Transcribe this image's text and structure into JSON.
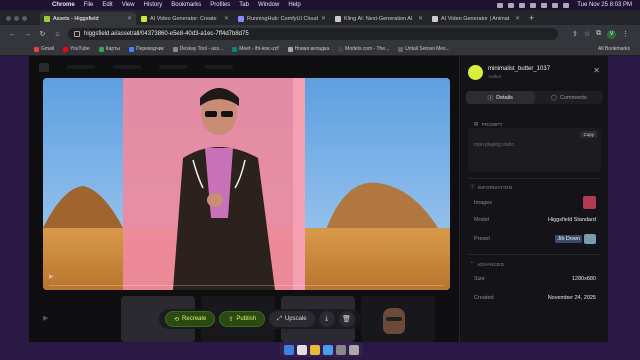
{
  "menubar": {
    "app_name": "Chrome",
    "items": [
      "File",
      "Edit",
      "View",
      "History",
      "Bookmarks",
      "Profiles",
      "Tab",
      "Window",
      "Help"
    ],
    "clock": "Tue Nov 25  8:03 PM"
  },
  "tabs": [
    {
      "title": "Assets - Higgsfield",
      "color": "#9acd32",
      "active": true
    },
    {
      "title": "AI Video Generator: Create",
      "color": "#c8e63c",
      "active": false
    },
    {
      "title": "RunningHub: ComfyUI Cloud",
      "color": "#8888ff",
      "active": false
    },
    {
      "title": "Kling AI: Next-Generation AI",
      "color": "#cccccc",
      "active": false
    },
    {
      "title": "AI Video Generator | Animat",
      "color": "#cccccc",
      "active": false
    }
  ],
  "address_bar": {
    "url": "higgsfield.ai/asset/all/04373860-e5e8-40d3-a1ec-7ff4d7b8d75"
  },
  "bookmarks": [
    {
      "label": "Gmail",
      "color": "#ea4335"
    },
    {
      "label": "YouTube",
      "color": "#ff0000"
    },
    {
      "label": "Карты",
      "color": "#34a853"
    },
    {
      "label": "Переводчик",
      "color": "#4285f4"
    },
    {
      "label": "Deskay Tool - ass...",
      "color": "#888888"
    },
    {
      "label": "Meet - iht-iesc-zzf",
      "color": "#00897b"
    },
    {
      "label": "Новая вкладка",
      "color": "#aaaaaa"
    },
    {
      "label": "Models.com - The...",
      "color": "#444444"
    },
    {
      "label": "Untail Sensei Mes...",
      "color": "#666666"
    }
  ],
  "bookmarks_all": "All Bookmarks",
  "actions": {
    "recreate": "Recreate",
    "publish": "Publish",
    "upscale": "Upscale"
  },
  "panel": {
    "username": "minimalist_butter_1037",
    "user_subtitle": "Author",
    "tab_details": "Details",
    "tab_comments": "Comments",
    "prompt_heading": "PROMPT",
    "copy_label": "Copy",
    "prompt_text": "man playing static",
    "info_heading": "INFORMATION",
    "images_label": "Images",
    "model_label": "Model",
    "model_value": "Higgsfield Standard",
    "preset_label": "Preset",
    "preset_value": "Jib Down",
    "advanced_heading": "ADVANCED",
    "size_label": "Size",
    "size_value": "1280x680",
    "created_label": "Created",
    "created_value": "November 24, 2025"
  }
}
